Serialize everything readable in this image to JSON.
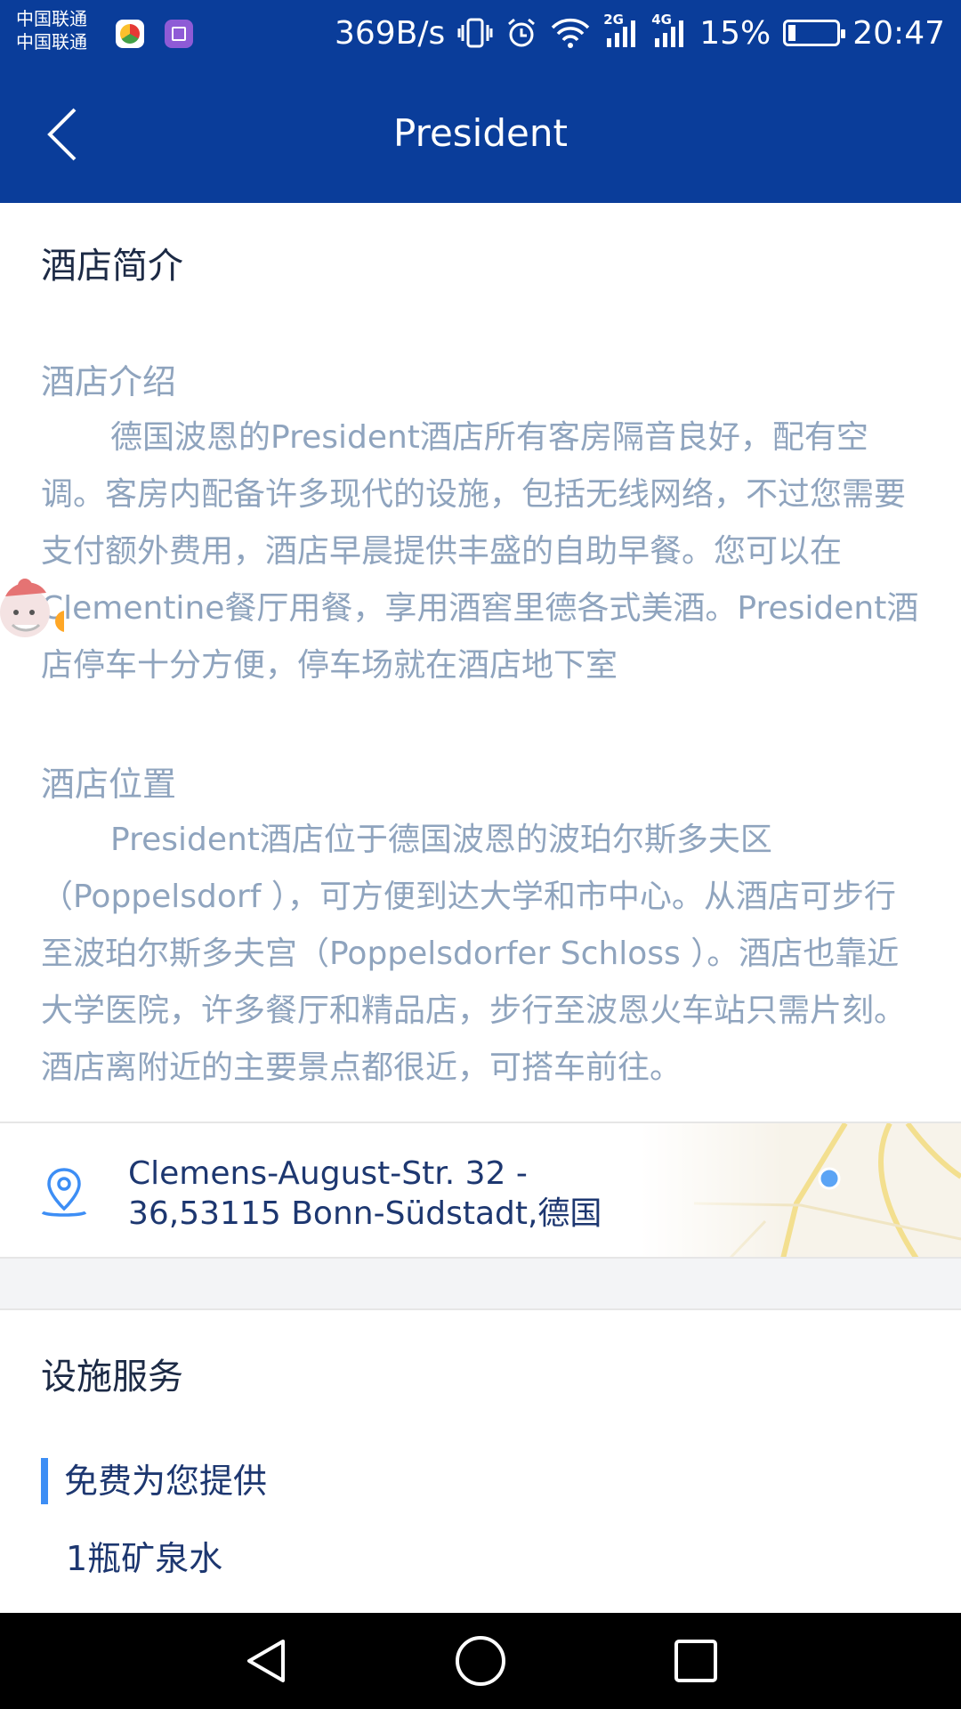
{
  "status_bar": {
    "carrier_1": "中国联通",
    "carrier_2": "中国联通",
    "net_speed": "369B/s",
    "net_2g": "2G",
    "net_4g": "4G",
    "battery_pct": "15%",
    "battery_level": 0.15,
    "time": "20:47"
  },
  "header": {
    "title": "President"
  },
  "intro": {
    "section_title": "酒店简介",
    "about_label": "酒店介绍",
    "about_text": "德国波恩的President酒店所有客房隔音良好，配有空调。客房内配备许多现代的设施，包括无线网络，不过您需要支付额外费用，酒店早晨提供丰盛的自助早餐。您可以在Clementine餐厅用餐，享用酒窖里德各式美酒。President酒店停车十分方便，停车场就在酒店地下室",
    "location_label": "酒店位置",
    "location_text": "President酒店位于德国波恩的波珀尔斯多夫区（Poppelsdorf ），可方便到达大学和市中心。从酒店可步行至波珀尔斯多夫宫（Poppelsdorfer Schloss ）。酒店也靠近大学医院，许多餐厅和精品店，步行至波恩火车站只需片刻。酒店离附近的主要景点都很近，可搭车前往。"
  },
  "address": {
    "line1": "Clemens-August-Str. 32 -",
    "line2": "36,53115 Bonn-Südstadt,德国"
  },
  "facilities": {
    "section_title": "设施服务",
    "free_label": "免费为您提供",
    "items": [
      "1瓶矿泉水"
    ]
  },
  "colors": {
    "header_bg": "#0a3d9a",
    "accent": "#3d8ef5",
    "muted_text": "#8fa4be",
    "dark_text": "#1d3770"
  }
}
